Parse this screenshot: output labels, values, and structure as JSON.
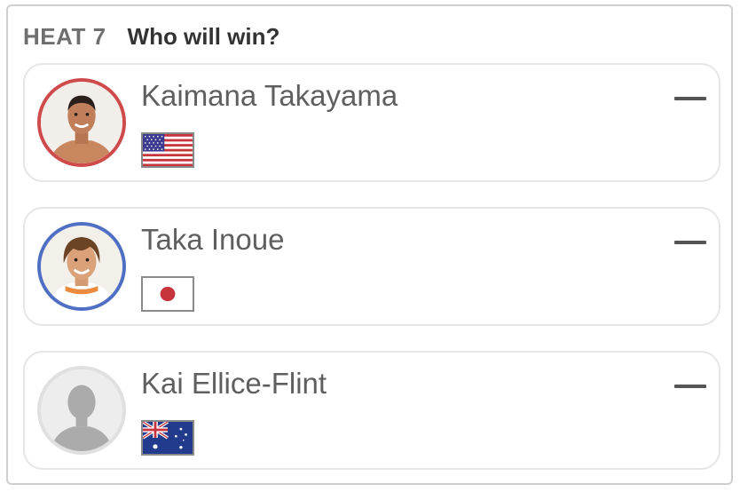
{
  "header": {
    "heat_label": "HEAT 7",
    "question": "Who will win?"
  },
  "colors": {
    "red_ring": "#cf4b4b",
    "blue_ring": "#4f6fc4",
    "grey_ring": "#e0e0e0"
  },
  "surfers": [
    {
      "name": "Kaimana Takayama",
      "flag": "us-flag",
      "ring": "red",
      "selection": "—"
    },
    {
      "name": "Taka Inoue",
      "flag": "japan-flag",
      "ring": "blue",
      "selection": "—"
    },
    {
      "name": "Kai Ellice-Flint",
      "flag": "australia-flag",
      "ring": "grey",
      "selection": "—"
    }
  ]
}
